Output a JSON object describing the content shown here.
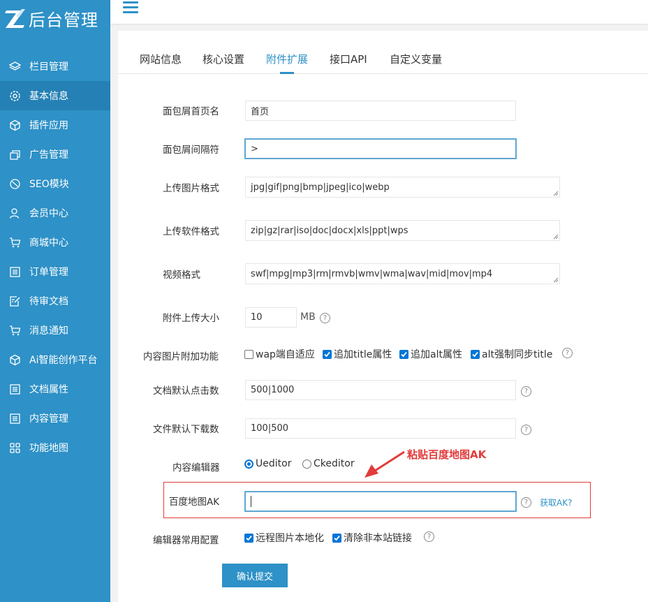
{
  "app": {
    "title": "后台管理"
  },
  "sidebar": {
    "items": [
      {
        "label": "栏目管理",
        "icon": "layers-icon"
      },
      {
        "label": "基本信息",
        "icon": "gear-icon",
        "active": true
      },
      {
        "label": "插件应用",
        "icon": "cube-icon"
      },
      {
        "label": "广告管理",
        "icon": "ad-icon"
      },
      {
        "label": "SEO模块",
        "icon": "seo-icon"
      },
      {
        "label": "会员中心",
        "icon": "user-icon"
      },
      {
        "label": "商城中心",
        "icon": "cart-icon"
      },
      {
        "label": "订单管理",
        "icon": "list-icon"
      },
      {
        "label": "待审文档",
        "icon": "edit-doc-icon"
      },
      {
        "label": "消息通知",
        "icon": "cart-icon"
      },
      {
        "label": "Ai智能创作平台",
        "icon": "cube-icon"
      },
      {
        "label": "文档属性",
        "icon": "list-icon"
      },
      {
        "label": "内容管理",
        "icon": "list-icon"
      },
      {
        "label": "功能地图",
        "icon": "grid-icon"
      }
    ]
  },
  "tabs": [
    {
      "label": "网站信息"
    },
    {
      "label": "核心设置"
    },
    {
      "label": "附件扩展",
      "active": true
    },
    {
      "label": "接口API"
    },
    {
      "label": "自定义变量"
    }
  ],
  "form": {
    "breadcrumb_home": {
      "label": "面包屑首页名",
      "value": "首页"
    },
    "breadcrumb_sep": {
      "label": "面包屑间隔符",
      "value": ">"
    },
    "img_formats": {
      "label": "上传图片格式",
      "value": "jpg|gif|png|bmp|jpeg|ico|webp"
    },
    "soft_formats": {
      "label": "上传软件格式",
      "value": "zip|gz|rar|iso|doc|docx|xls|ppt|wps"
    },
    "video_formats": {
      "label": "视频格式",
      "value": "swf|mpg|mp3|rm|rmvb|wmv|wma|wav|mid|mov|mp4"
    },
    "upload_size": {
      "label": "附件上传大小",
      "value": "10",
      "unit": "MB"
    },
    "img_extra": {
      "label": "内容图片附加功能",
      "options": [
        {
          "label": "wap端自适应",
          "checked": false
        },
        {
          "label": "追加title属性",
          "checked": true
        },
        {
          "label": "追加alt属性",
          "checked": true
        },
        {
          "label": "alt强制同步title",
          "checked": true
        }
      ]
    },
    "default_clicks": {
      "label": "文档默认点击数",
      "value": "500|1000"
    },
    "default_downloads": {
      "label": "文件默认下载数",
      "value": "100|500"
    },
    "editor": {
      "label": "内容编辑器",
      "options": [
        {
          "label": "Ueditor",
          "checked": true
        },
        {
          "label": "Ckeditor",
          "checked": false
        }
      ]
    },
    "baidu_ak": {
      "label": "百度地图AK",
      "value": "",
      "link": "获取AK?"
    },
    "editor_config": {
      "label": "编辑器常用配置",
      "options": [
        {
          "label": "远程图片本地化",
          "checked": true
        },
        {
          "label": "清除非本站链接",
          "checked": true
        }
      ]
    },
    "help_glyph": "?",
    "submit": "确认提交"
  },
  "annotation": {
    "text": "粘贴百度地图AK",
    "color": "#e23b3b"
  },
  "colors": {
    "sidebar": "#2e91c7",
    "accent": "#2e91c7",
    "checkbox": "#0075d6"
  }
}
